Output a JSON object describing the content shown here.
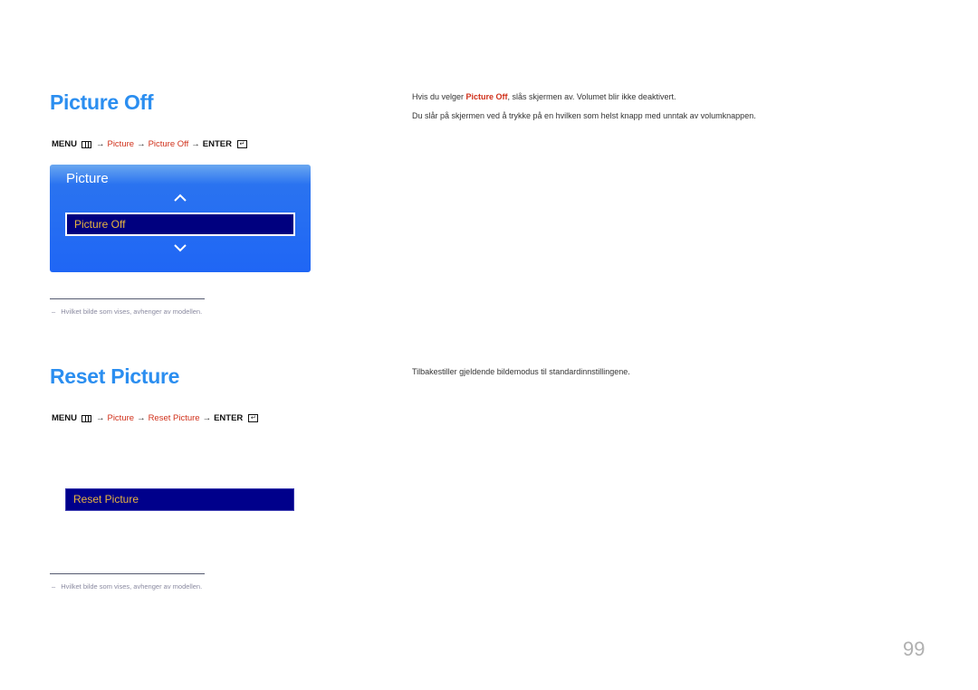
{
  "sections": [
    {
      "title": "Picture Off",
      "path": {
        "menu": "MENU",
        "arrow": "→",
        "step1": "Picture",
        "step2": "Picture Off",
        "enter": "ENTER"
      },
      "osd": {
        "title": "Picture",
        "selected_item": "Picture Off"
      },
      "note": "Hvilket bilde som vises, avhenger av modellen.",
      "description": [
        {
          "before": "Hvis du velger ",
          "highlight": "Picture Off",
          "after": ", slås skjermen av. Volumet blir ikke deaktivert."
        },
        {
          "text": "Du slår på skjermen ved å trykke på en hvilken som helst knapp med unntak av volumknappen."
        }
      ]
    },
    {
      "title": "Reset Picture",
      "path": {
        "menu": "MENU",
        "arrow": "→",
        "step1": "Picture",
        "step2": "Reset Picture",
        "enter": "ENTER"
      },
      "osd": {
        "selected_item": "Reset Picture"
      },
      "note": "Hvilket bilde som vises, avhenger av modellen.",
      "description": [
        {
          "text": "Tilbakestiller gjeldende bildemodus til standardinnstillingene."
        }
      ]
    }
  ],
  "note_dash": "–",
  "page_number": "99",
  "colors": {
    "heading": "#2b8ef0",
    "highlight_red": "#d0301a",
    "osd_blue": "#1f66f5",
    "osd_selected_bg": "#00007f",
    "osd_selected_text": "#e8b440"
  }
}
